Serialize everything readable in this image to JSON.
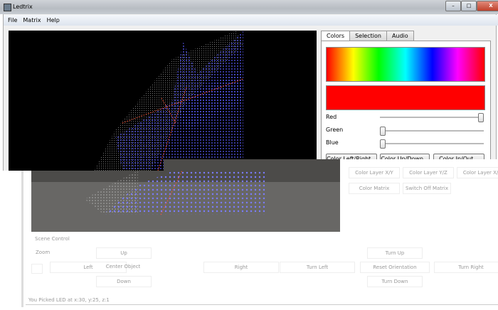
{
  "window": {
    "title": "Ledtrix",
    "minimize": "–",
    "maximize": "□",
    "close": "X"
  },
  "menu": [
    "File",
    "Matrix",
    "Help"
  ],
  "tabs": [
    {
      "label": "Colors",
      "active": true
    },
    {
      "label": "Selection"
    },
    {
      "label": "Audio"
    }
  ],
  "colors": {
    "current_color": "#ff0000",
    "sliders": [
      {
        "label": "Red",
        "value": 255,
        "max": 255
      },
      {
        "label": "Green",
        "value": 0,
        "max": 255
      },
      {
        "label": "Blue",
        "value": 0,
        "max": 255
      }
    ],
    "buttons": [
      "Color Left/Right...",
      "Color Up/Down...",
      "Color In/Out..."
    ],
    "layer_buttons": [
      "Color Layer X/Y",
      "Color Layer Y/Z",
      "Color Layer X/Z"
    ],
    "matrix_buttons": [
      "Color Matrix",
      "Switch Off Matrix"
    ]
  },
  "scene": {
    "title": "Scene Control",
    "zoom_label": "Zoom",
    "up": "Up",
    "left": "Left",
    "center": "Center Object",
    "right": "Right",
    "down": "Down",
    "turn_up": "Turn Up",
    "turn_left": "Turn Left",
    "reset": "Reset Orientation",
    "turn_right": "Turn Right",
    "turn_down": "Turn Down"
  },
  "status": "You Picked LED at x:30, y:25, z:1",
  "palette": {
    "led_blue": "#5a5cff",
    "led_red": "#ff5030",
    "led_white": "#cccccc"
  }
}
